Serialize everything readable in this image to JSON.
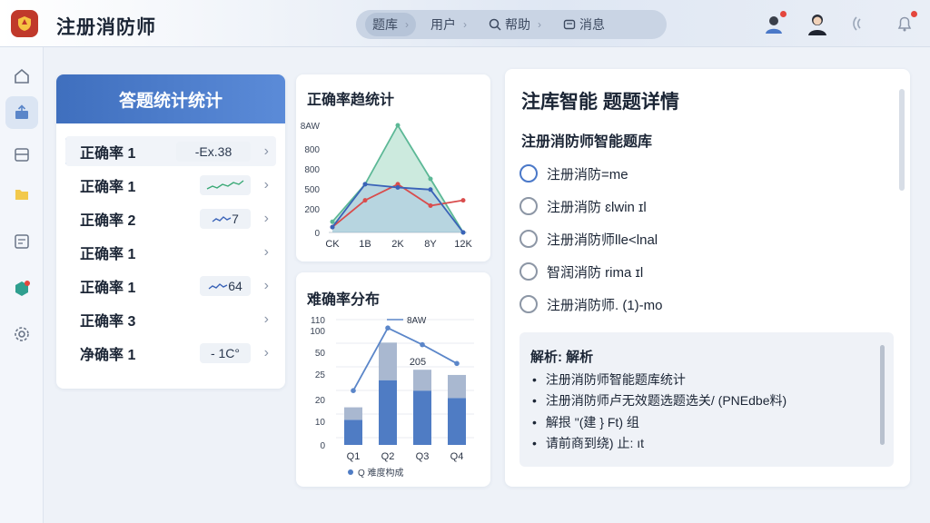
{
  "header": {
    "app_title": "注册消防师",
    "nav": [
      {
        "label": "题库",
        "icon": "chart-icon"
      },
      {
        "label": "用户",
        "icon": "user-icon"
      },
      {
        "label": "帮助",
        "icon": "search-icon"
      },
      {
        "label": "消息",
        "icon": "message-icon"
      }
    ]
  },
  "stats_panel": {
    "title": "答题统计统计",
    "rows": [
      {
        "label": "正确率 1",
        "chip": "-Ex.38",
        "chip_kind": "text"
      },
      {
        "label": "正确率 1",
        "chip": "",
        "chip_kind": "spark-up"
      },
      {
        "label": "正确率 2",
        "chip": "7",
        "chip_kind": "spark-wave"
      },
      {
        "label": "正确率 1",
        "chip": "",
        "chip_kind": "none"
      },
      {
        "label": "正确率 1",
        "chip": "64",
        "chip_kind": "spark-text"
      },
      {
        "label": "正确率 3",
        "chip": "",
        "chip_kind": "none"
      },
      {
        "label": "净确率 1",
        "chip": "- 1C°",
        "chip_kind": "text"
      }
    ]
  },
  "chart_data": [
    {
      "type": "line",
      "title": "正确率趋统计",
      "y_ticks": [
        "0",
        "200",
        "500",
        "800",
        "800",
        "8AW"
      ],
      "x_ticks": [
        "CK",
        "1B",
        "2K",
        "8Y",
        "12K"
      ],
      "series": [
        {
          "color": "#5cb896",
          "points": [
            [
              0,
              100
            ],
            [
              1,
              450
            ],
            [
              2,
              1000
            ],
            [
              3,
              500
            ],
            [
              4,
              0
            ]
          ]
        },
        {
          "color": "#d94c4c",
          "points": [
            [
              0,
              50
            ],
            [
              1,
              300
            ],
            [
              2,
              450
            ],
            [
              3,
              250
            ],
            [
              4,
              300
            ]
          ]
        },
        {
          "color": "#3a63b8",
          "points": [
            [
              0,
              50
            ],
            [
              1,
              450
            ],
            [
              2,
              420
            ],
            [
              3,
              400
            ],
            [
              4,
              0
            ]
          ]
        }
      ],
      "ylim": [
        0,
        1000
      ]
    },
    {
      "type": "bar",
      "title": "难确率分布",
      "y_ticks": [
        "0",
        "10",
        "20",
        "25",
        "50",
        "100",
        "110"
      ],
      "categories": [
        "Q1",
        "Q2",
        "Q3",
        "Q4"
      ],
      "series": [
        {
          "name": "",
          "color": "#4f7cc4",
          "values": [
            24,
            62,
            52,
            45
          ]
        },
        {
          "name": "",
          "color": "#a9b8d0",
          "values": [
            12,
            36,
            20,
            22
          ]
        }
      ],
      "line_values": [
        52,
        112,
        96,
        78
      ],
      "line_label": "8AW",
      "bar_label": "205",
      "legend_label": "Q 难度构成",
      "ylim": [
        0,
        120
      ]
    }
  ],
  "detail": {
    "title": "注库智能  题题详情",
    "subtitle": "注册消防师智能题库",
    "options": [
      {
        "label": "注册消防=me",
        "checked": true
      },
      {
        "label": "注册消防 ɛlwin ɪl",
        "checked": false
      },
      {
        "label": "注册消防师lle<lnal",
        "checked": false
      },
      {
        "label": "智润消防 rima ɪl",
        "checked": false
      },
      {
        "label": "注册消防师. (1)-mo",
        "checked": false
      }
    ],
    "analysis_title": "解析: 解析",
    "analysis_items": [
      "注册消防师智能题库统计",
      "注册消防师卢无效题选题选关/ (PNEdbe料)",
      "解拫 \"(建 } Ft) 组",
      "请前商到绕) 止: ıt"
    ]
  }
}
